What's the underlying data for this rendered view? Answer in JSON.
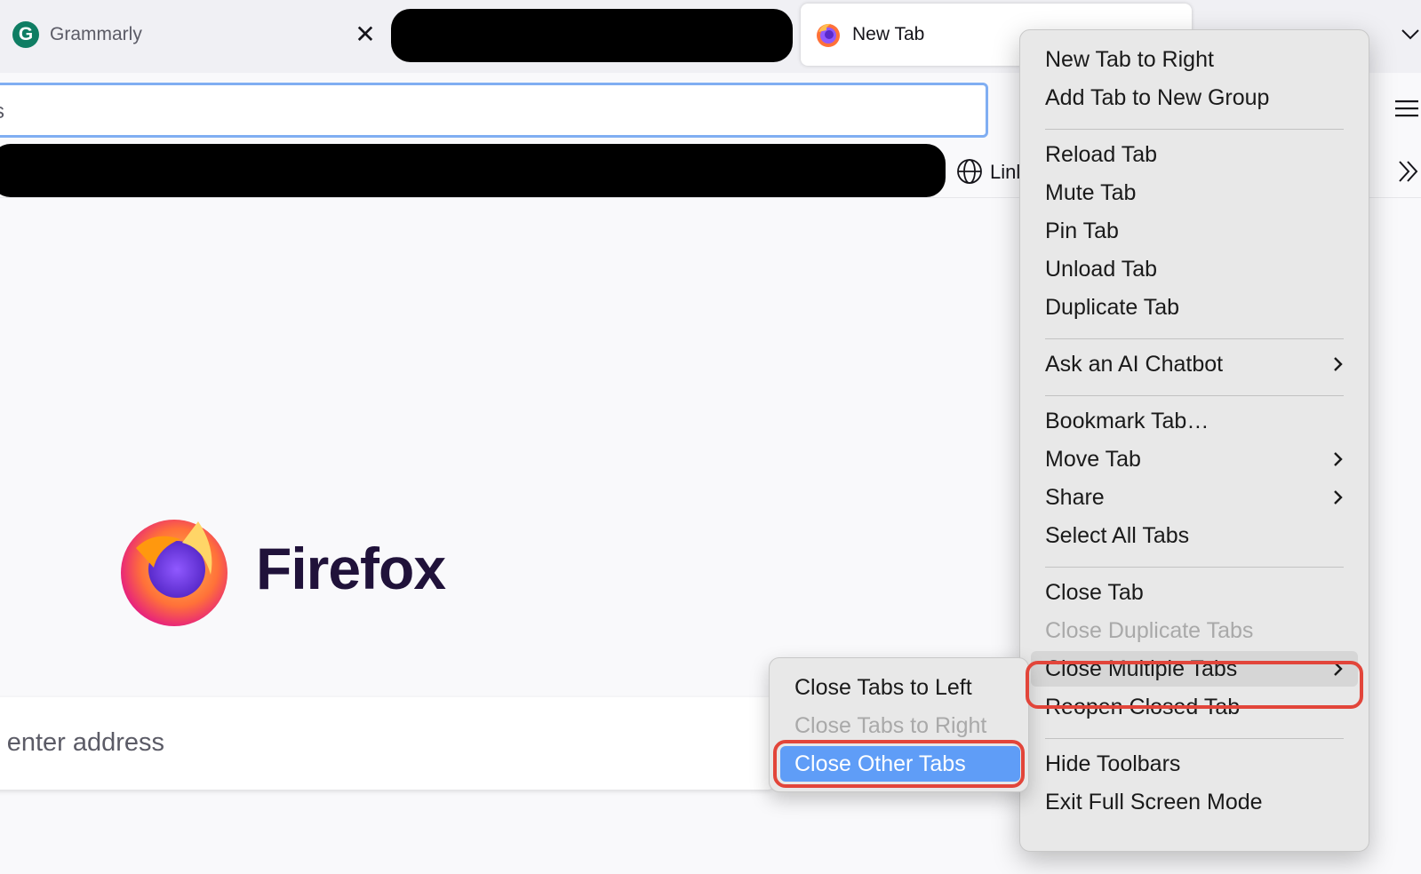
{
  "tabs": {
    "grammarly": {
      "title": "Grammarly",
      "close_glyph": "✕",
      "icon": "grammarly-icon",
      "icon_letter": "G"
    },
    "new_tab": {
      "title": "New Tab",
      "icon": "firefox-icon"
    }
  },
  "toolbar": {
    "url_text": "s",
    "menu_icon": "hamburger-menu-icon"
  },
  "bookmarks": {
    "partial_label": "Linl",
    "globe_icon": "globe-icon",
    "overflow_icon": "chevron-double-right-icon"
  },
  "content": {
    "wordmark": "Firefox",
    "search_text": "r enter address"
  },
  "context_menu": {
    "items": [
      {
        "label": "New Tab to Right"
      },
      {
        "label": "Add Tab to New Group"
      },
      {
        "label": "Reload Tab"
      },
      {
        "label": "Mute Tab"
      },
      {
        "label": "Pin Tab"
      },
      {
        "label": "Unload Tab"
      },
      {
        "label": "Duplicate Tab"
      },
      {
        "label": "Ask an AI Chatbot",
        "submenu": true
      },
      {
        "label": "Bookmark Tab…"
      },
      {
        "label": "Move Tab",
        "submenu": true
      },
      {
        "label": "Share",
        "submenu": true
      },
      {
        "label": "Select All Tabs"
      },
      {
        "label": "Close Tab"
      },
      {
        "label": "Close Duplicate Tabs",
        "disabled": true
      },
      {
        "label": "Close Multiple Tabs",
        "submenu": true,
        "highlighted": true
      },
      {
        "label": "Reopen Closed Tab"
      },
      {
        "label": "Hide Toolbars"
      },
      {
        "label": "Exit Full Screen Mode"
      }
    ]
  },
  "submenu": {
    "items": [
      {
        "label": "Close Tabs to Left"
      },
      {
        "label": "Close Tabs to Right",
        "disabled": true
      },
      {
        "label": "Close Other Tabs",
        "selected": true
      }
    ]
  },
  "colors": {
    "highlight_ring": "#e2453a",
    "selected_bg": "#5f9df7",
    "focus_ring": "#80aef2"
  }
}
